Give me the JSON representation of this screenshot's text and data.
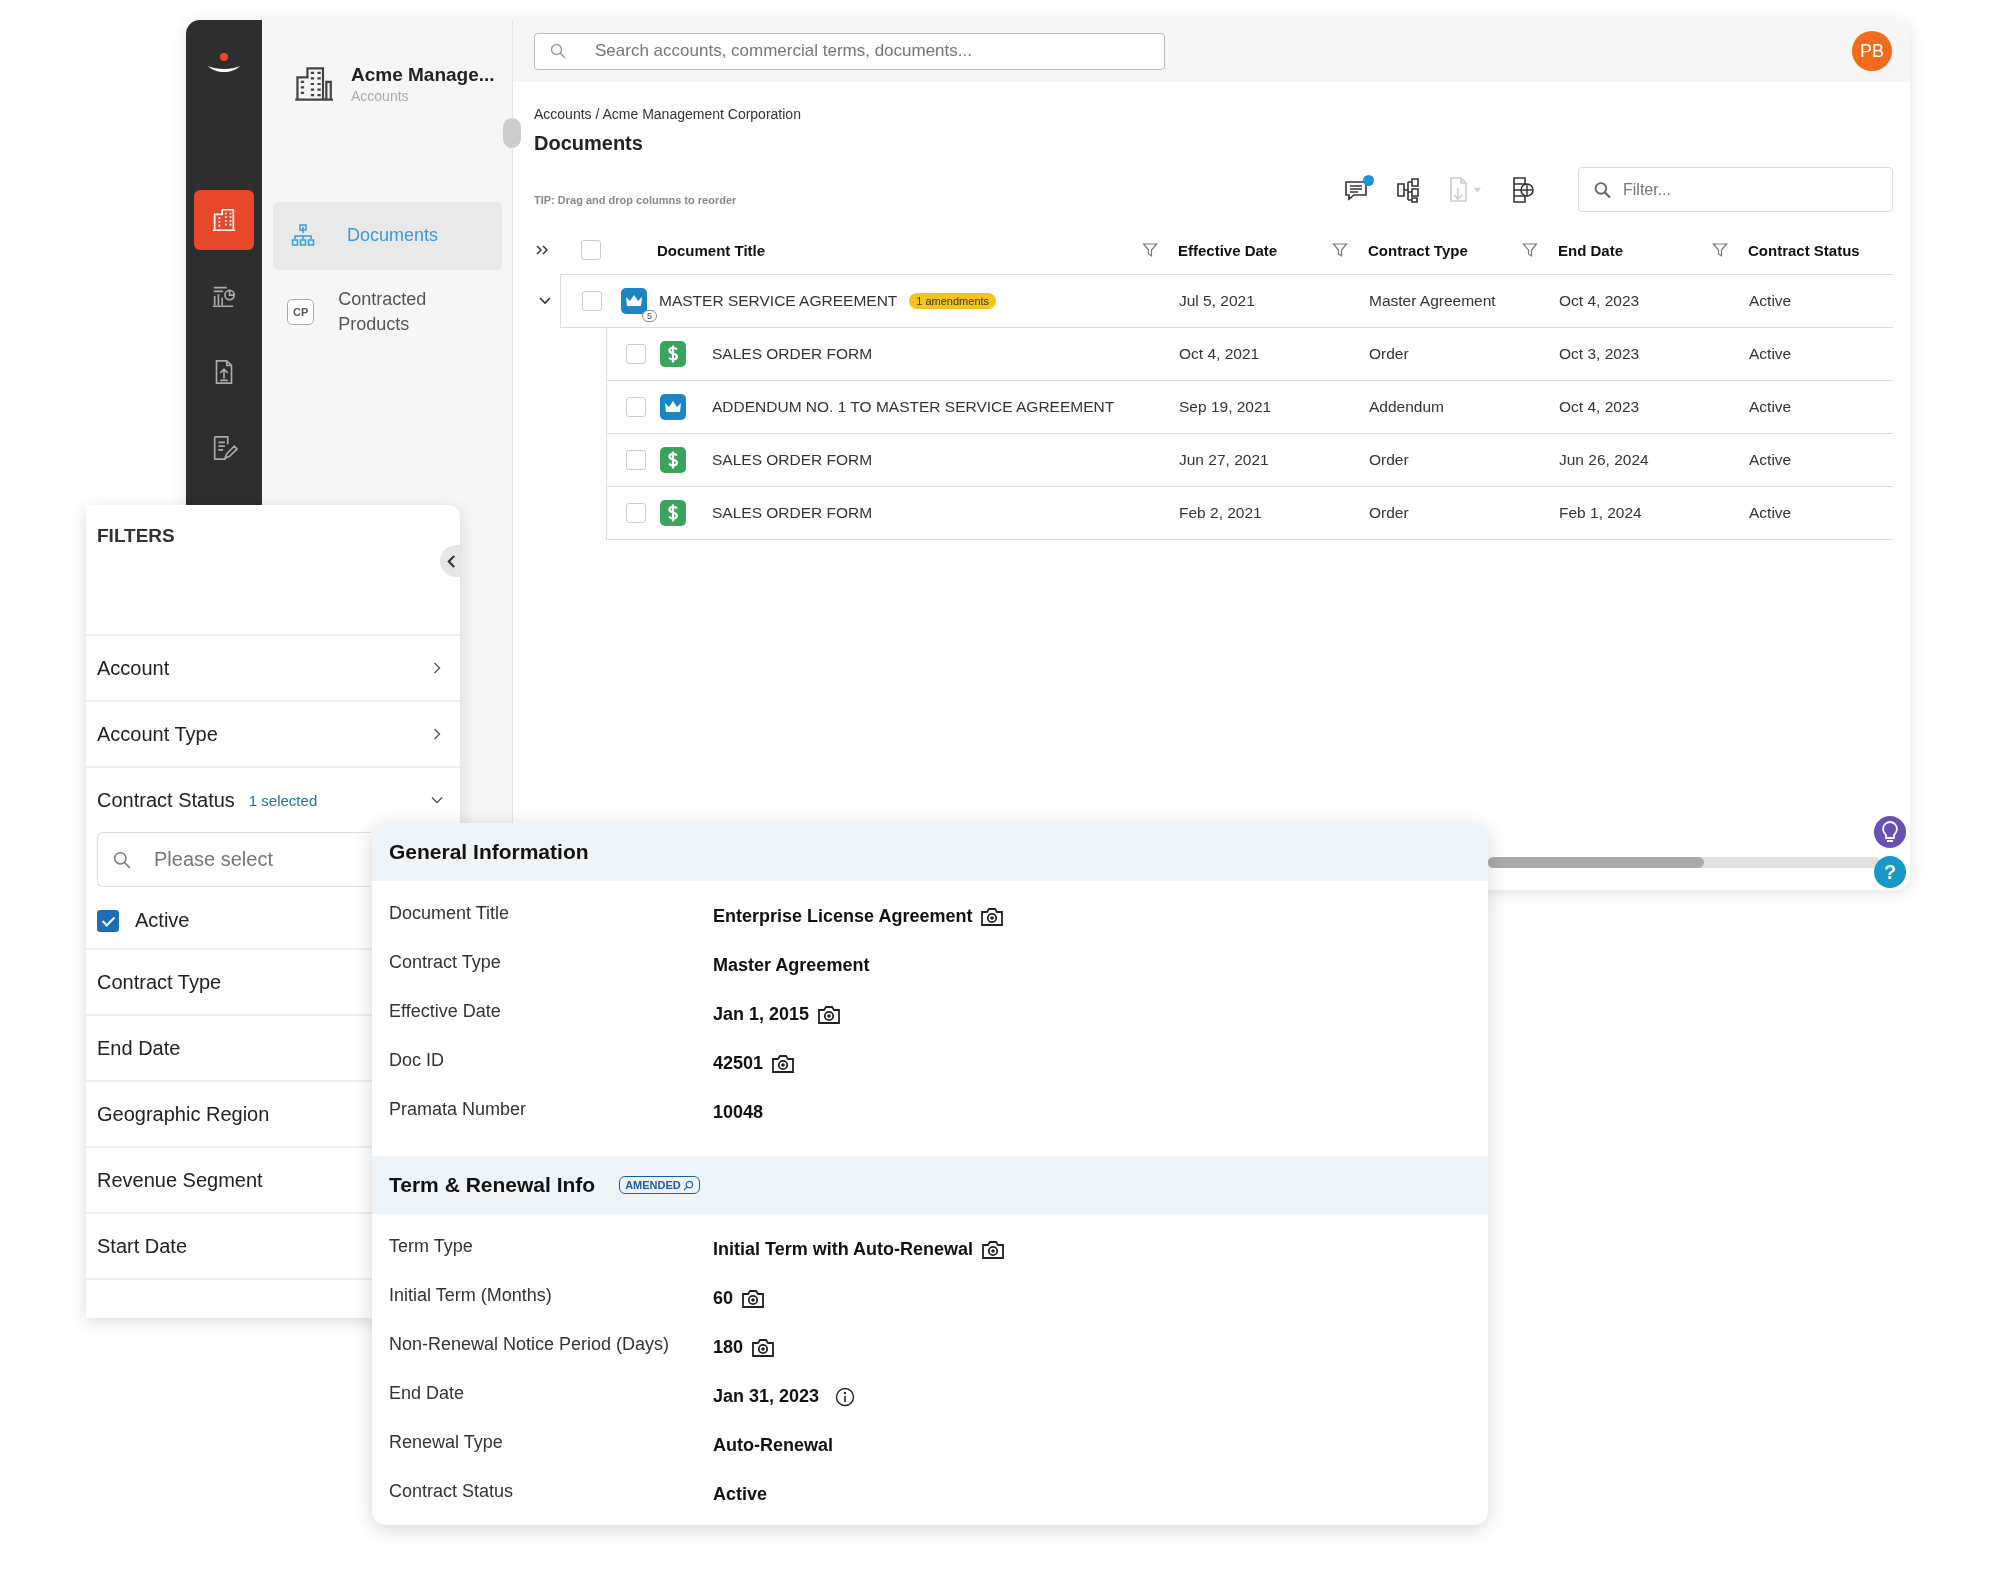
{
  "rail": {
    "items": [
      {
        "kind": "building",
        "selected": true
      },
      {
        "kind": "report",
        "selected": false
      },
      {
        "kind": "upload",
        "selected": false
      },
      {
        "kind": "edit",
        "selected": false
      }
    ]
  },
  "sidebar": {
    "title": "Acme Manage...",
    "subtitle": "Accounts",
    "items": [
      {
        "label": "Documents",
        "selected": true,
        "kind": "tree"
      },
      {
        "label": "Contracted Products",
        "selected": false,
        "kind": "tag",
        "tag": "CP"
      }
    ]
  },
  "search": {
    "placeholder": "Search accounts, commercial terms, documents..."
  },
  "avatar": "PB",
  "breadcrumb": "Accounts / Acme Management Corporation",
  "page_title": "Documents",
  "tip": "TIP: Drag and drop columns to reorder",
  "toolbar": [
    {
      "kind": "comments",
      "unread": true,
      "disabled": false
    },
    {
      "kind": "hierarchy",
      "unread": false,
      "disabled": false
    },
    {
      "kind": "export",
      "unread": false,
      "disabled": true
    },
    {
      "kind": "columns",
      "unread": false,
      "disabled": false
    }
  ],
  "filter_field": {
    "placeholder": "Filter..."
  },
  "table": {
    "all_checked": false,
    "columns": [
      {
        "label": "Document Title",
        "filter": true
      },
      {
        "label": "Effective Date",
        "filter": true
      },
      {
        "label": "Contract Type",
        "filter": true
      },
      {
        "label": "End Date",
        "filter": true
      },
      {
        "label": "Contract Status",
        "filter": false
      }
    ],
    "rows": [
      {
        "kind": "crown",
        "count": "5",
        "badge": "1 amendments",
        "checked": false,
        "expanded": true,
        "cells": [
          "MASTER SERVICE AGREEMENT",
          "Jul 5, 2021",
          "Master Agreement",
          "Oct 4, 2023",
          "Active"
        ],
        "children": [
          {
            "kind": "dollar",
            "checked": false,
            "cells": [
              "SALES ORDER FORM",
              "Oct 4, 2021",
              "Order",
              "Oct 3, 2023",
              "Active"
            ]
          },
          {
            "kind": "crown",
            "checked": false,
            "cells": [
              "ADDENDUM NO. 1 TO MASTER SERVICE AGREEMENT",
              "Sep 19, 2021",
              "Addendum",
              "Oct 4, 2023",
              "Active"
            ]
          },
          {
            "kind": "dollar",
            "checked": false,
            "cells": [
              "SALES ORDER FORM",
              "Jun 27, 2021",
              "Order",
              "Jun 26, 2024",
              "Active"
            ]
          },
          {
            "kind": "dollar",
            "checked": false,
            "cells": [
              "SALES ORDER FORM",
              "Feb 2, 2021",
              "Order",
              "Feb 1, 2024",
              "Active"
            ]
          }
        ]
      }
    ]
  },
  "help_label": "?",
  "filters": {
    "title": "FILTERS",
    "sections": [
      {
        "label": "Account",
        "expanded": false
      },
      {
        "label": "Account Type",
        "expanded": false
      },
      {
        "label": "Contract Status",
        "expanded": true,
        "note": "1 selected",
        "search_placeholder": "Please select",
        "options": [
          {
            "label": "Active",
            "checked": true
          }
        ]
      },
      {
        "label": "Contract Type"
      },
      {
        "label": "End Date"
      },
      {
        "label": "Geographic Region"
      },
      {
        "label": "Revenue Segment"
      },
      {
        "label": "Start Date"
      }
    ]
  },
  "details": {
    "sections": [
      {
        "title": "General Information",
        "fields": [
          {
            "label": "Document Title",
            "value": "Enterprise License Agreement",
            "kind": "camera"
          },
          {
            "label": "Contract Type",
            "value": "Master Agreement",
            "kind": "plain"
          },
          {
            "label": "Effective Date",
            "value": "Jan 1, 2015",
            "kind": "camera"
          },
          {
            "label": "Doc ID",
            "value": "42501",
            "kind": "camera"
          },
          {
            "label": "Pramata Number",
            "value": "10048",
            "kind": "plain"
          }
        ]
      },
      {
        "title": "Term & Renewal Info",
        "tag": "AMENDED",
        "fields": [
          {
            "label": "Term Type",
            "value": "Initial Term with Auto-Renewal",
            "kind": "camera"
          },
          {
            "label": "Initial Term (Months)",
            "value": "60",
            "kind": "camera"
          },
          {
            "label": "Non-Renewal Notice Period (Days)",
            "value": "180",
            "kind": "camera"
          },
          {
            "label": "End Date",
            "value": "Jan 31, 2023",
            "kind": "info"
          },
          {
            "label": "Renewal Type",
            "value": "Auto-Renewal",
            "kind": "plain"
          },
          {
            "label": "Contract Status",
            "value": "Active",
            "kind": "plain"
          }
        ]
      }
    ]
  }
}
